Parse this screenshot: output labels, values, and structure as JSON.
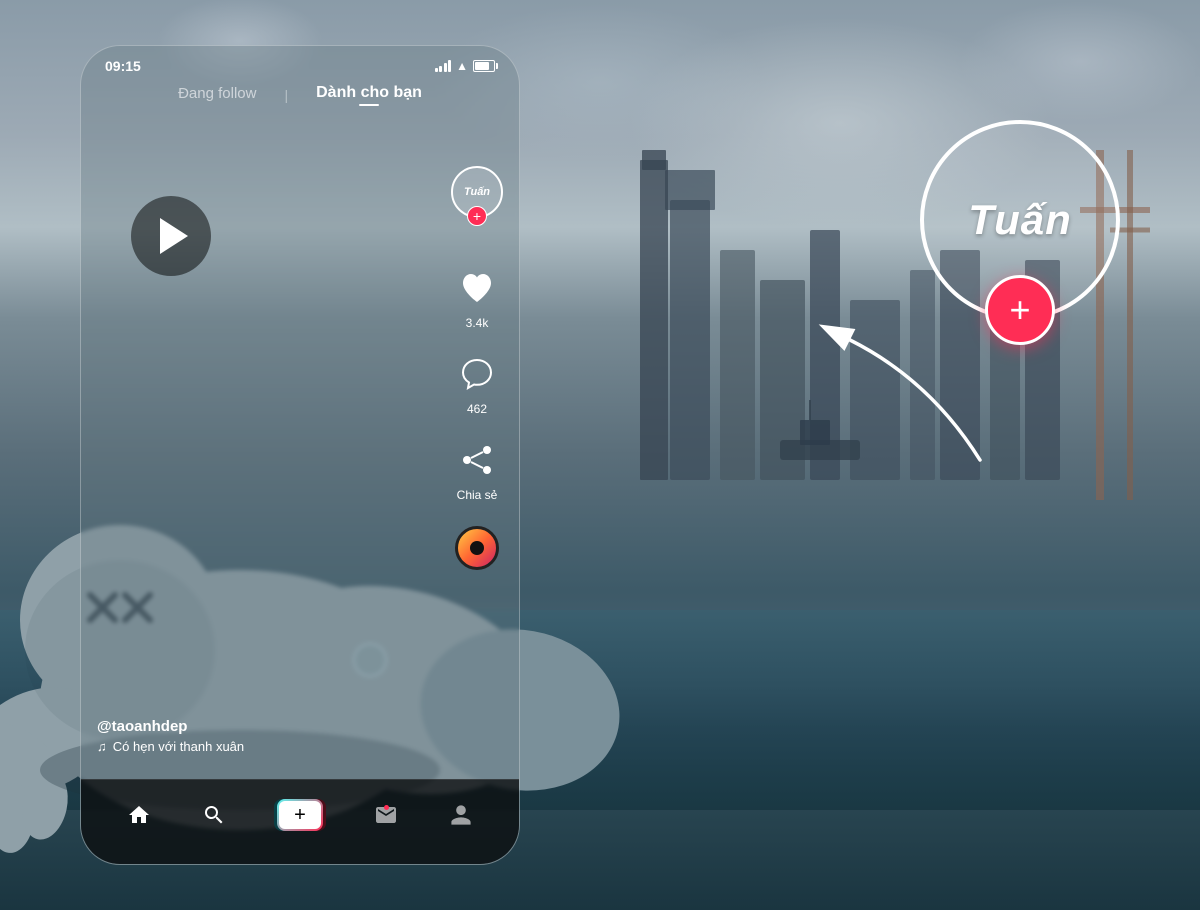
{
  "status_bar": {
    "time": "09:15"
  },
  "nav_tabs": {
    "following_label": "Đang follow",
    "for_you_label": "Dành cho bạn",
    "separator": "|"
  },
  "avatar": {
    "text": "Tuấn",
    "tuan_text": "Tuấn"
  },
  "actions": {
    "like_count": "3.4k",
    "comment_count": "462",
    "share_label": "Chia sẻ"
  },
  "video_info": {
    "username": "@taoanhdep",
    "music": "Có hẹn với thanh xuân"
  },
  "bottom_nav": {
    "home_label": "Home",
    "search_label": "Search",
    "create_label": "+",
    "inbox_label": "Inbox",
    "profile_label": "Profile"
  },
  "annotation": {
    "tuan_label": "Tuấn",
    "plus_label": "+"
  },
  "colors": {
    "accent": "#ff2d55",
    "tiktok_cyan": "#20d5ec",
    "bg_dark": "#1a1a2e"
  }
}
